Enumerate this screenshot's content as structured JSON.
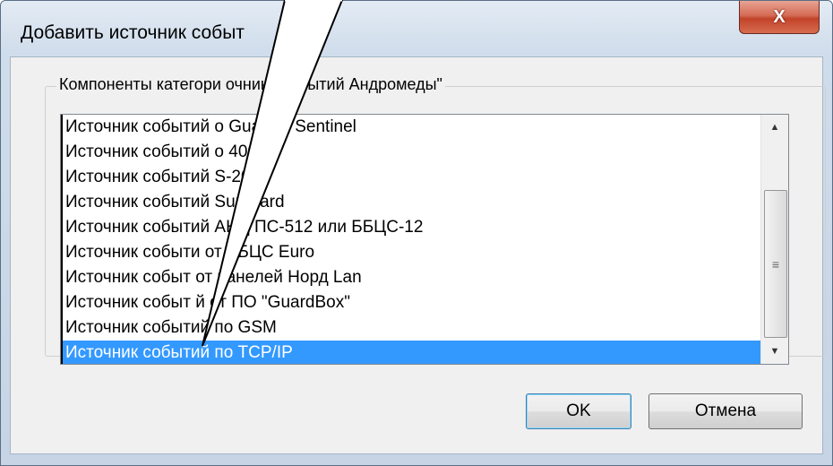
{
  "window": {
    "title": "Добавить источник событ",
    "close_glyph": "X"
  },
  "group": {
    "label": "Компоненты категори       очники событий Андромеды\""
  },
  "list": {
    "items": [
      "Источник событий о       Guard и Sentinel",
      "Источник событий о       4000",
      "Источник событий       S-200",
      "Источник событий       Sur-Gard",
      "Источник событий       АНД ПС-512 или ББЦС-12",
      "Источник событи   от ББЦС Euro",
      "Источник событ   от панелей Норд Lan",
      "Источник событ  й от ПО \"GuardBox\"",
      "Источник событий по GSM",
      "Источник событий по TCP/IP"
    ],
    "selected_index": 9
  },
  "scrollbar": {
    "up_icon": "scroll-up-arrow",
    "down_icon": "scroll-down-arrow"
  },
  "buttons": {
    "ok": "OK",
    "cancel": "Отмена"
  },
  "colors": {
    "selection": "#3399ff",
    "close_button": "#c2432a"
  }
}
